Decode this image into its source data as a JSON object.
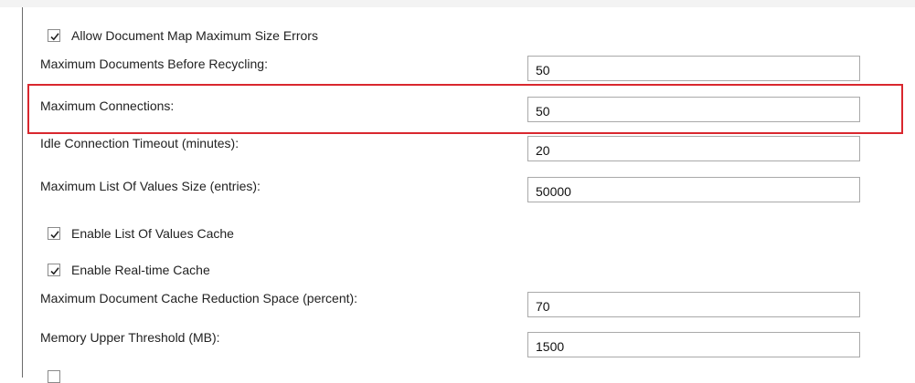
{
  "settings": {
    "allow_doc_map_errors": {
      "label": "Allow Document Map Maximum Size Errors",
      "checked": true
    },
    "max_docs_recycling": {
      "label": "Maximum Documents Before Recycling:",
      "value": "50"
    },
    "max_connections": {
      "label": "Maximum Connections:",
      "value": "50"
    },
    "idle_timeout": {
      "label": "Idle Connection Timeout (minutes):",
      "value": "20"
    },
    "max_lov_size": {
      "label": "Maximum List Of Values Size (entries):",
      "value": "50000"
    },
    "enable_lov_cache": {
      "label": "Enable List Of Values Cache",
      "checked": true
    },
    "enable_realtime_cache": {
      "label": "Enable Real-time Cache",
      "checked": true
    },
    "max_cache_reduction": {
      "label": "Maximum Document Cache Reduction Space (percent):",
      "value": "70"
    },
    "memory_upper_threshold": {
      "label": "Memory Upper Threshold (MB):",
      "value": "1500"
    }
  },
  "colors": {
    "highlight_border": "#d9272e",
    "field_border": "#a9a9a9"
  },
  "icons": {
    "checkbox": "check-icon"
  }
}
